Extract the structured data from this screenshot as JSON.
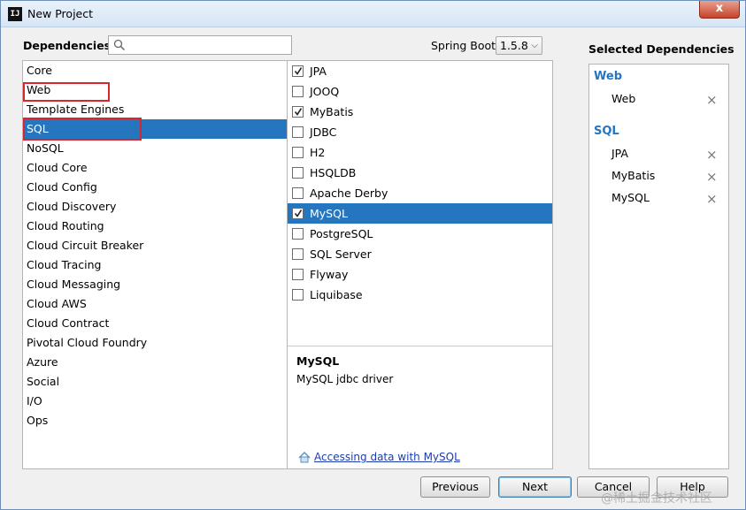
{
  "window": {
    "title": "New Project",
    "close_label": "x",
    "app_icon": "intellij-idea-icon"
  },
  "header": {
    "dependencies_label": "Dependencies",
    "search": {
      "placeholder": "",
      "value": ""
    },
    "spring_boot_label": "Spring Boot",
    "spring_boot_version": "1.5.8"
  },
  "categories": [
    {
      "label": "Core"
    },
    {
      "label": "Web"
    },
    {
      "label": "Template Engines"
    },
    {
      "label": "SQL"
    },
    {
      "label": "NoSQL"
    },
    {
      "label": "Cloud Core"
    },
    {
      "label": "Cloud Config"
    },
    {
      "label": "Cloud Discovery"
    },
    {
      "label": "Cloud Routing"
    },
    {
      "label": "Cloud Circuit Breaker"
    },
    {
      "label": "Cloud Tracing"
    },
    {
      "label": "Cloud Messaging"
    },
    {
      "label": "Cloud AWS"
    },
    {
      "label": "Cloud Contract"
    },
    {
      "label": "Pivotal Cloud Foundry"
    },
    {
      "label": "Azure"
    },
    {
      "label": "Social"
    },
    {
      "label": "I/O"
    },
    {
      "label": "Ops"
    }
  ],
  "selected_category": "SQL",
  "dependencies": [
    {
      "label": "JPA",
      "checked": true
    },
    {
      "label": "JOOQ",
      "checked": false
    },
    {
      "label": "MyBatis",
      "checked": true
    },
    {
      "label": "JDBC",
      "checked": false
    },
    {
      "label": "H2",
      "checked": false
    },
    {
      "label": "HSQLDB",
      "checked": false
    },
    {
      "label": "Apache Derby",
      "checked": false
    },
    {
      "label": "MySQL",
      "checked": true
    },
    {
      "label": "PostgreSQL",
      "checked": false
    },
    {
      "label": "SQL Server",
      "checked": false
    },
    {
      "label": "Flyway",
      "checked": false
    },
    {
      "label": "Liquibase",
      "checked": false
    }
  ],
  "selected_dependency": "MySQL",
  "info": {
    "title": "MySQL",
    "description": "MySQL jdbc driver",
    "guide_link": "Accessing data with MySQL",
    "guide_icon": "home-icon"
  },
  "selected_panel": {
    "heading": "Selected Dependencies",
    "groups": [
      {
        "name": "Web",
        "items": [
          "Web"
        ]
      },
      {
        "name": "SQL",
        "items": [
          "JPA",
          "MyBatis",
          "MySQL"
        ]
      }
    ],
    "remove_icon": "×"
  },
  "buttons": {
    "previous": "Previous",
    "next": "Next",
    "cancel": "Cancel",
    "help": "Help"
  },
  "watermark": "@稀土掘金技术社区",
  "colors": {
    "selection": "#2675bf",
    "highlight_box": "#d9252c",
    "link": "#1a3bb0"
  }
}
